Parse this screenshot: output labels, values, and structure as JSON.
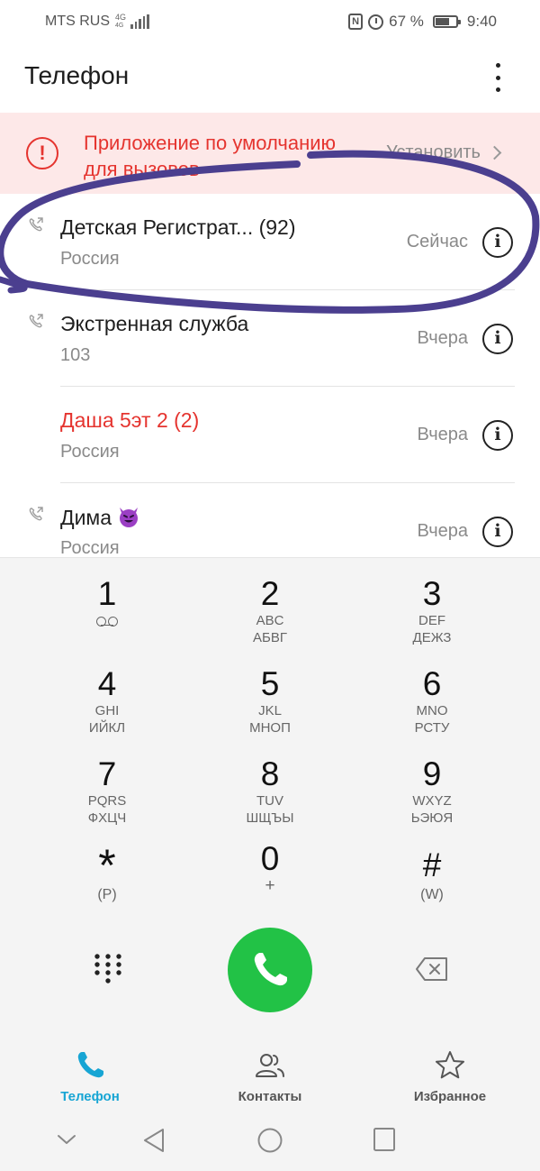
{
  "status_bar": {
    "carrier": "MTS RUS",
    "network_type_top": "4G",
    "network_type_bottom": "4G",
    "battery_percent": "67 %",
    "battery_level": 0.67,
    "time": "9:40"
  },
  "header": {
    "title": "Телефон",
    "menu_icon": "more-vertical-icon"
  },
  "banner": {
    "icon": "alert-circle-icon",
    "message": "Приложение по умолчанию для вызовов",
    "action_label": "Установить",
    "color": "#e5342f",
    "background": "#fde8e8"
  },
  "call_log": [
    {
      "name": "Детская Регистрат... (92)",
      "subtitle": "Россия",
      "time": "Сейчас",
      "missed": false,
      "direction_icon": "outgoing-call-icon"
    },
    {
      "name": "Экстренная служба",
      "subtitle": "103",
      "time": "Вчера",
      "missed": false,
      "direction_icon": "outgoing-call-icon"
    },
    {
      "name": "Даша 5эт 2 (2)",
      "subtitle": "Россия",
      "time": "Вчера",
      "missed": true,
      "direction_icon": ""
    },
    {
      "name": "Дима",
      "subtitle": "Россия",
      "time": "Вчера",
      "missed": false,
      "direction_icon": "outgoing-call-icon",
      "emoji": "smiling-devil-emoji"
    }
  ],
  "dialpad": {
    "keys": [
      {
        "digit": "1",
        "line1": "",
        "line2": "",
        "icon": "voicemail-icon"
      },
      {
        "digit": "2",
        "line1": "ABC",
        "line2": "АБВГ"
      },
      {
        "digit": "3",
        "line1": "DEF",
        "line2": "ДЕЖЗ"
      },
      {
        "digit": "4",
        "line1": "GHI",
        "line2": "ИЙКЛ"
      },
      {
        "digit": "5",
        "line1": "JKL",
        "line2": "МНОП"
      },
      {
        "digit": "6",
        "line1": "MNO",
        "line2": "РСТУ"
      },
      {
        "digit": "7",
        "line1": "PQRS",
        "line2": "ФХЦЧ"
      },
      {
        "digit": "8",
        "line1": "TUV",
        "line2": "ШЩЪЫ"
      },
      {
        "digit": "9",
        "line1": "WXYZ",
        "line2": "ЬЭЮЯ"
      },
      {
        "digit": "*",
        "line1": "(P)",
        "line2": ""
      },
      {
        "digit": "0",
        "line1": "+",
        "line2": ""
      },
      {
        "digit": "#",
        "line1": "(W)",
        "line2": ""
      }
    ],
    "call_button_color": "#22c246"
  },
  "bottom_nav": [
    {
      "label": "Телефон",
      "icon": "phone-icon",
      "active": true
    },
    {
      "label": "Контакты",
      "icon": "contacts-icon",
      "active": false
    },
    {
      "label": "Избранное",
      "icon": "star-icon",
      "active": false
    }
  ],
  "accent_color": "#17a5d4",
  "annotation_color": "#4b3f8f"
}
